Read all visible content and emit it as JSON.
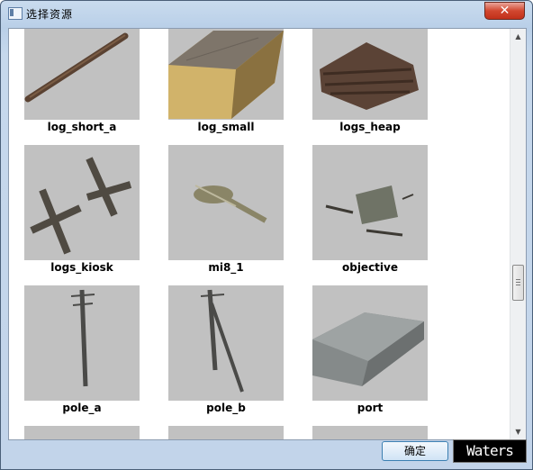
{
  "window": {
    "title": "选择资源",
    "close_glyph": "✕"
  },
  "tiles_row1": [
    {
      "label": "log_short_a",
      "icon": "log-short-icon"
    },
    {
      "label": "log_small",
      "icon": "log-small-icon"
    },
    {
      "label": "logs_heap",
      "icon": "logs-heap-icon"
    }
  ],
  "tiles_row2": [
    {
      "label": "logs_kiosk",
      "icon": "logs-kiosk-icon"
    },
    {
      "label": "mi8_1",
      "icon": "helicopter-icon"
    },
    {
      "label": "objective",
      "icon": "objective-icon"
    }
  ],
  "tiles_row3": [
    {
      "label": "pole_a",
      "icon": "pole-a-icon"
    },
    {
      "label": "pole_b",
      "icon": "pole-b-icon"
    },
    {
      "label": "port",
      "icon": "port-icon"
    }
  ],
  "scrollbar": {
    "up_glyph": "▲",
    "down_glyph": "▼",
    "position_fraction": 0.62
  },
  "buttons": {
    "ok": "确定"
  },
  "watermark": "Waters",
  "colors": {
    "thumb_bg": "#c1c1c1",
    "titlebar": "#c6d8ec",
    "close": "#c1301a"
  }
}
